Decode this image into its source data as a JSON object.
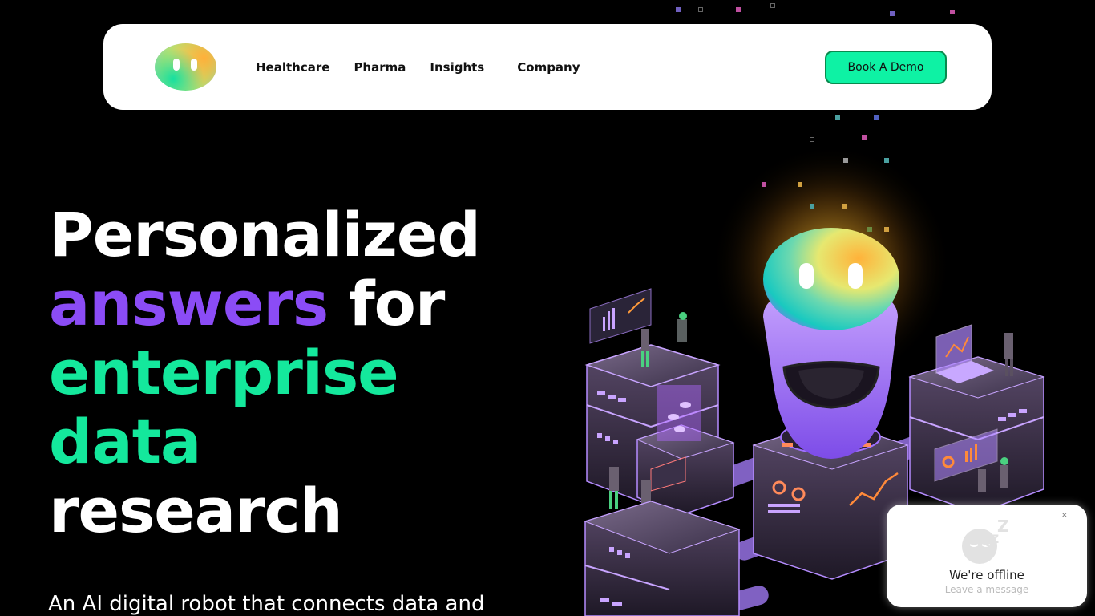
{
  "nav": {
    "logo_alt": "robot logo",
    "links": [
      "Healthcare",
      "Pharma",
      "Insights",
      "Company"
    ],
    "cta_label": "Book A Demo"
  },
  "hero": {
    "line1": "Personalized",
    "line2_accent": "answers",
    "line2_rest": "for",
    "line3": "enterprise",
    "line4": "data",
    "line5": "research",
    "subtitle": "An AI digital robot that connects data and"
  },
  "chat": {
    "status": "We're offline",
    "link_label": "Leave a message",
    "close_label": "×",
    "icon": "sleeping-face-icon"
  },
  "colors": {
    "accent_purple": "#8b4cf6",
    "accent_green": "#14e89c",
    "cta_green": "#0ef2a4"
  }
}
